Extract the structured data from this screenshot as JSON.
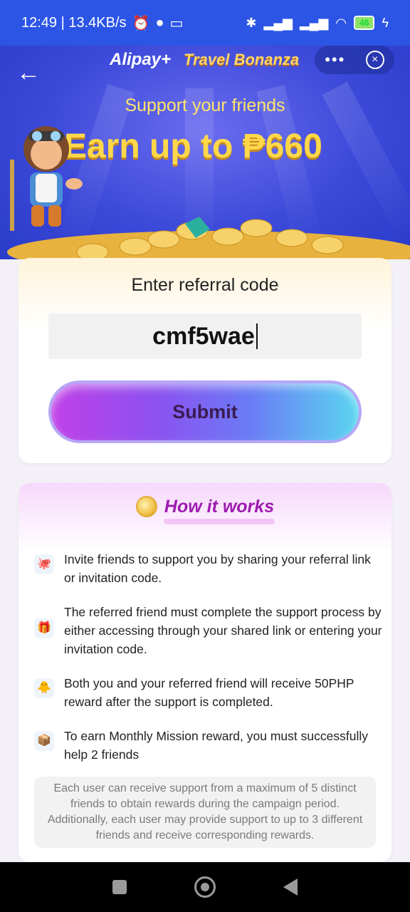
{
  "status_bar": {
    "time_speed": "12:49 | 13.4KB/s",
    "battery": "46",
    "status_icons": [
      "alarm-icon",
      "chat-icon",
      "screen-icon",
      "bluetooth-icon",
      "signal-icon",
      "wifi-icon",
      "battery-icon",
      "charging-icon"
    ]
  },
  "header": {
    "brand_alipay": "Alipay+",
    "brand_campaign": "Travel Bonanza",
    "more_label": "•••",
    "close_label": "×"
  },
  "hero": {
    "subtitle": "Support your friends",
    "title": "Earn up to ₱660"
  },
  "referral": {
    "label": "Enter referral code",
    "code_value": "cmf5wae",
    "submit_label": "Submit"
  },
  "how_it_works": {
    "title": "How it works",
    "steps": [
      {
        "icon": "share-icon",
        "text": "Invite friends to support you by sharing your referral link or invitation code."
      },
      {
        "icon": "link-icon",
        "text": "The referred friend must complete the support process by either accessing through your shared link or entering your invitation code."
      },
      {
        "icon": "reward-icon",
        "text": "Both you and your referred friend will receive 50PHP reward after the support is completed."
      },
      {
        "icon": "mission-icon",
        "text": "To earn Monthly Mission reward, you must successfully help 2 friends"
      }
    ],
    "note": "Each user can receive support from a maximum of 5 distinct friends to obtain rewards during the campaign period. Additionally, each user may provide support to up to 3 different friends and receive corresponding rewards."
  },
  "colors": {
    "primary_blue": "#2c55e6",
    "gold": "#ffd84a",
    "purple_title": "#9e1bb0"
  }
}
